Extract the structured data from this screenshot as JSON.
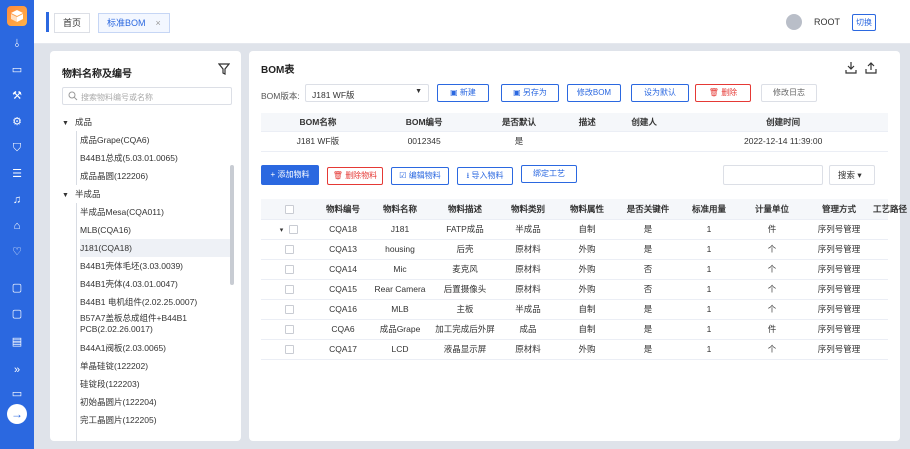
{
  "colors": {
    "primary": "#2b68e0",
    "danger": "#e53935",
    "logo": "#ff8a3d"
  },
  "rail": {
    "icons": [
      "logo-icon",
      "chart-icon",
      "box-icon",
      "factory-icon",
      "settings-icon",
      "shield-icon",
      "list-icon",
      "bell-icon",
      "store-icon",
      "badge-icon",
      "monitor-icon",
      "monitor-icon",
      "document-icon",
      "double-chevron-icon",
      "folder-icon",
      "arrow-right-icon"
    ]
  },
  "topbar": {
    "tabs": [
      {
        "label": "首页"
      },
      {
        "label": "标准BOM",
        "close": "×"
      }
    ],
    "user": "ROOT",
    "switch_label": "切换"
  },
  "left": {
    "title": "物料名称及编号",
    "search_placeholder": "搜索物料编号或名称",
    "tree": [
      {
        "label": "成品",
        "caret": "▼",
        "level": 0
      },
      {
        "label": "成品Grape(CQA6)",
        "level": 1
      },
      {
        "label": "B44B1总成(5.03.01.0065)",
        "level": 1
      },
      {
        "label": "成品晶圆(122206)",
        "level": 1
      },
      {
        "label": "半成品",
        "caret": "▼",
        "level": 0
      },
      {
        "label": "半成品Mesa(CQA011)",
        "level": 1
      },
      {
        "label": "MLB(CQA16)",
        "level": 1
      },
      {
        "label": "J181(CQA18)",
        "level": 1,
        "selected": true
      },
      {
        "label": "B44B1壳体毛坯(3.03.0039)",
        "level": 1
      },
      {
        "label": "B44B1壳体(4.03.01.0047)",
        "level": 1
      },
      {
        "label": "B44B1 电机组件(2.02.25.0007)",
        "level": 1
      },
      {
        "label": "B57A7盖板总成组件+B44B1 PCB(2.02.26.0017)",
        "level": 1,
        "two": true
      },
      {
        "label": "B44A1阀板(2.03.0065)",
        "level": 1
      },
      {
        "label": "单晶硅锭(122202)",
        "level": 1
      },
      {
        "label": "硅锭段(122203)",
        "level": 1
      },
      {
        "label": "初始晶圆片(122204)",
        "level": 1
      },
      {
        "label": "完工晶圆片(122205)",
        "level": 1
      }
    ]
  },
  "right": {
    "title": "BOM表",
    "version_label": "BOM版本:",
    "version_value": "J181 WF版",
    "buttons": {
      "new": "新建",
      "save_as": "另存为",
      "modify": "修改BOM",
      "set_default": "设为默认",
      "delete": "删除",
      "log": "修改日志"
    },
    "bom_headers": [
      "BOM名称",
      "BOM编号",
      "是否默认",
      "描述",
      "创建人",
      "创建时间"
    ],
    "bom_row": [
      "J181 WF版",
      "0012345",
      "是",
      "",
      "",
      "2022-12-14 11:39:00"
    ],
    "actions": {
      "add": "添加物料",
      "delete": "删除物料",
      "edit": "编辑物料",
      "import": "导入物料",
      "bind": "绑定工艺"
    },
    "search_label": "搜索",
    "mat_headers": [
      "物料编号",
      "物料名称",
      "物料描述",
      "物料类别",
      "物料属性",
      "是否关键件",
      "标准用量",
      "计量单位",
      "管理方式",
      "工艺路径"
    ],
    "mat_rows": [
      {
        "cells": [
          "CQA18",
          "J181",
          "FATP成品",
          "半成品",
          "自制",
          "是",
          "1",
          "件",
          "序列号管理",
          ""
        ],
        "expand": "▾"
      },
      {
        "cells": [
          "CQA13",
          "housing",
          "后壳",
          "原材料",
          "外购",
          "是",
          "1",
          "个",
          "序列号管理",
          ""
        ]
      },
      {
        "cells": [
          "CQA14",
          "Mic",
          "麦克风",
          "原材料",
          "外购",
          "否",
          "1",
          "个",
          "序列号管理",
          ""
        ]
      },
      {
        "cells": [
          "CQA15",
          "Rear Camera",
          "后置摄像头",
          "原材料",
          "外购",
          "否",
          "1",
          "个",
          "序列号管理",
          ""
        ]
      },
      {
        "cells": [
          "CQA16",
          "MLB",
          "主板",
          "半成品",
          "自制",
          "是",
          "1",
          "个",
          "序列号管理",
          ""
        ]
      },
      {
        "cells": [
          "CQA6",
          "成品Grape",
          "加工完成后外屏",
          "成品",
          "自制",
          "是",
          "1",
          "件",
          "序列号管理",
          ""
        ]
      },
      {
        "cells": [
          "CQA17",
          "LCD",
          "液晶显示屏",
          "原材料",
          "外购",
          "是",
          "1",
          "个",
          "序列号管理",
          ""
        ]
      }
    ]
  }
}
